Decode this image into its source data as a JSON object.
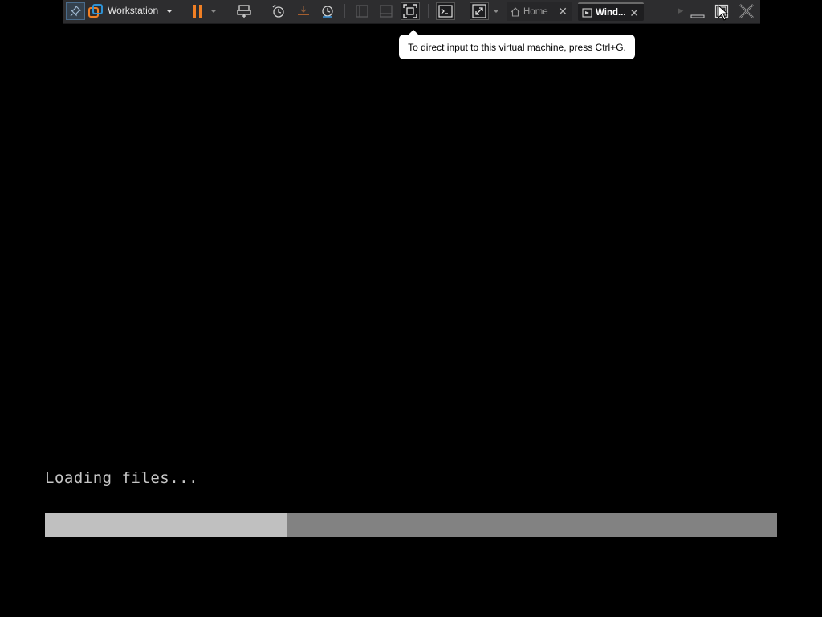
{
  "toolbar": {
    "app_label": "Workstation",
    "icons": {
      "pin": "pin-icon",
      "app": "vmware-workstation-icon",
      "pause": "pause-icon",
      "send_keys": "send-ctrl-alt-del-icon",
      "snapshot_take": "take-snapshot-icon",
      "snapshot_revert": "revert-snapshot-icon",
      "snapshot_manager": "snapshot-manager-icon",
      "view_library": "show-library-icon",
      "view_thumbnail": "show-thumbnail-bar-icon",
      "view_fullscreen": "full-screen-icon",
      "console": "console-view-icon",
      "stretch": "stretch-guest-icon"
    },
    "tabs": [
      {
        "label": "Home",
        "icon": "home-icon",
        "active": false
      },
      {
        "label": "Wind...",
        "icon": "vm-icon",
        "active": true
      }
    ],
    "colors": {
      "pause": "#f07f24",
      "background": "#2d2d2f"
    }
  },
  "tooltip": {
    "text": "To direct input to this virtual machine, press Ctrl+G."
  },
  "boot": {
    "status_text": "Loading files...",
    "progress_fraction": 0.33
  }
}
